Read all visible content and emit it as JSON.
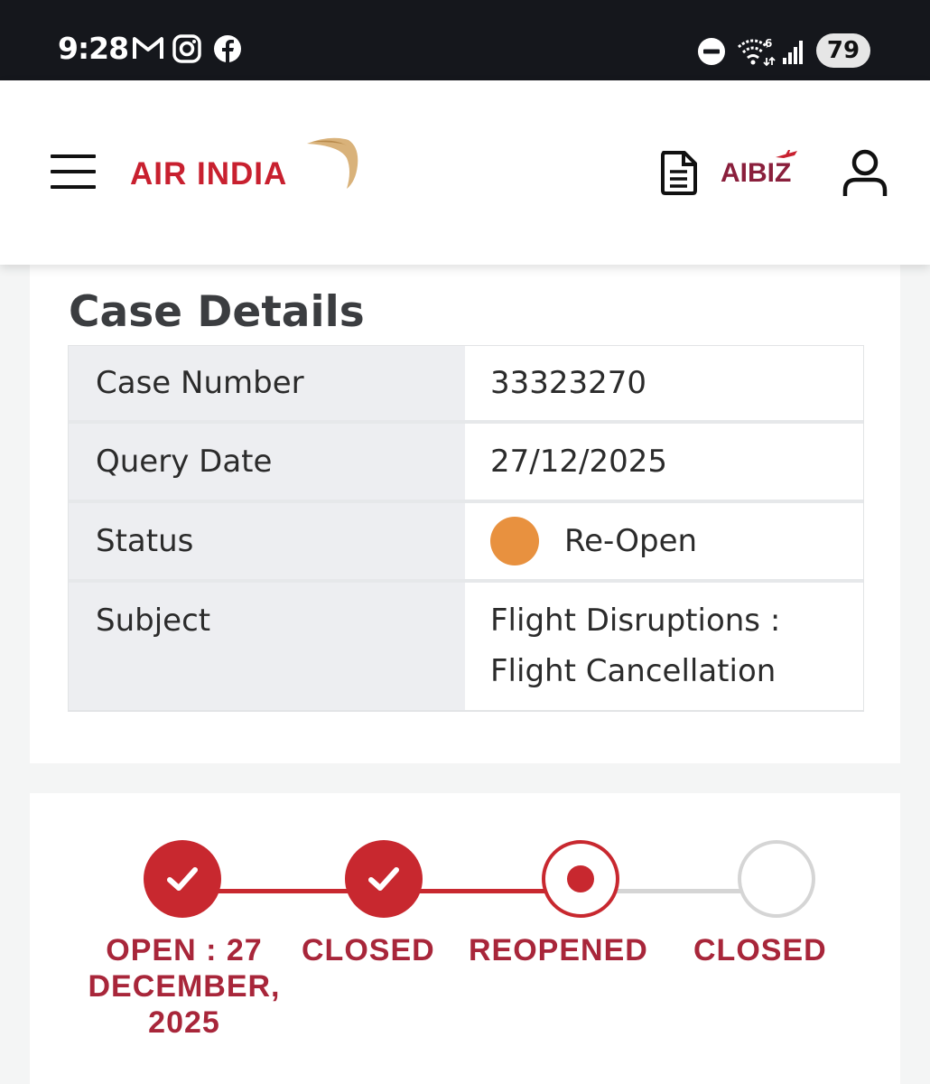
{
  "status_bar": {
    "time": "9:28",
    "battery": "79",
    "left_icons": [
      "gmail-icon",
      "instagram-icon",
      "facebook-icon"
    ],
    "right_icons": [
      "do-not-disturb-icon",
      "wifi-6-icon",
      "signal-icon",
      "battery-icon"
    ]
  },
  "header": {
    "logo": "AIR INDIA",
    "aibiz": "AIBIZ",
    "icons": [
      "menu-icon",
      "document-icon",
      "user-icon"
    ]
  },
  "case": {
    "title": "Case Details",
    "rows": [
      {
        "label": "Case Number",
        "value": "33323270"
      },
      {
        "label": "Query Date",
        "value": "27/12/2025"
      },
      {
        "label": "Status",
        "value": "Re-Open"
      },
      {
        "label": "Subject",
        "value": "Flight Disruptions :",
        "value_line2": "Flight Cancellation"
      }
    ],
    "status_color": "#e8913f"
  },
  "tracker": {
    "steps": [
      {
        "state": "done",
        "label_lines": [
          "OPEN : 27",
          "DECEMBER,",
          "2025"
        ]
      },
      {
        "state": "done",
        "label_lines": [
          "CLOSED"
        ]
      },
      {
        "state": "current",
        "label_lines": [
          "REOPENED"
        ]
      },
      {
        "state": "pending",
        "label_lines": [
          "CLOSED"
        ]
      }
    ],
    "accent_color": "#c8282f",
    "label_color": "#a8263a"
  }
}
